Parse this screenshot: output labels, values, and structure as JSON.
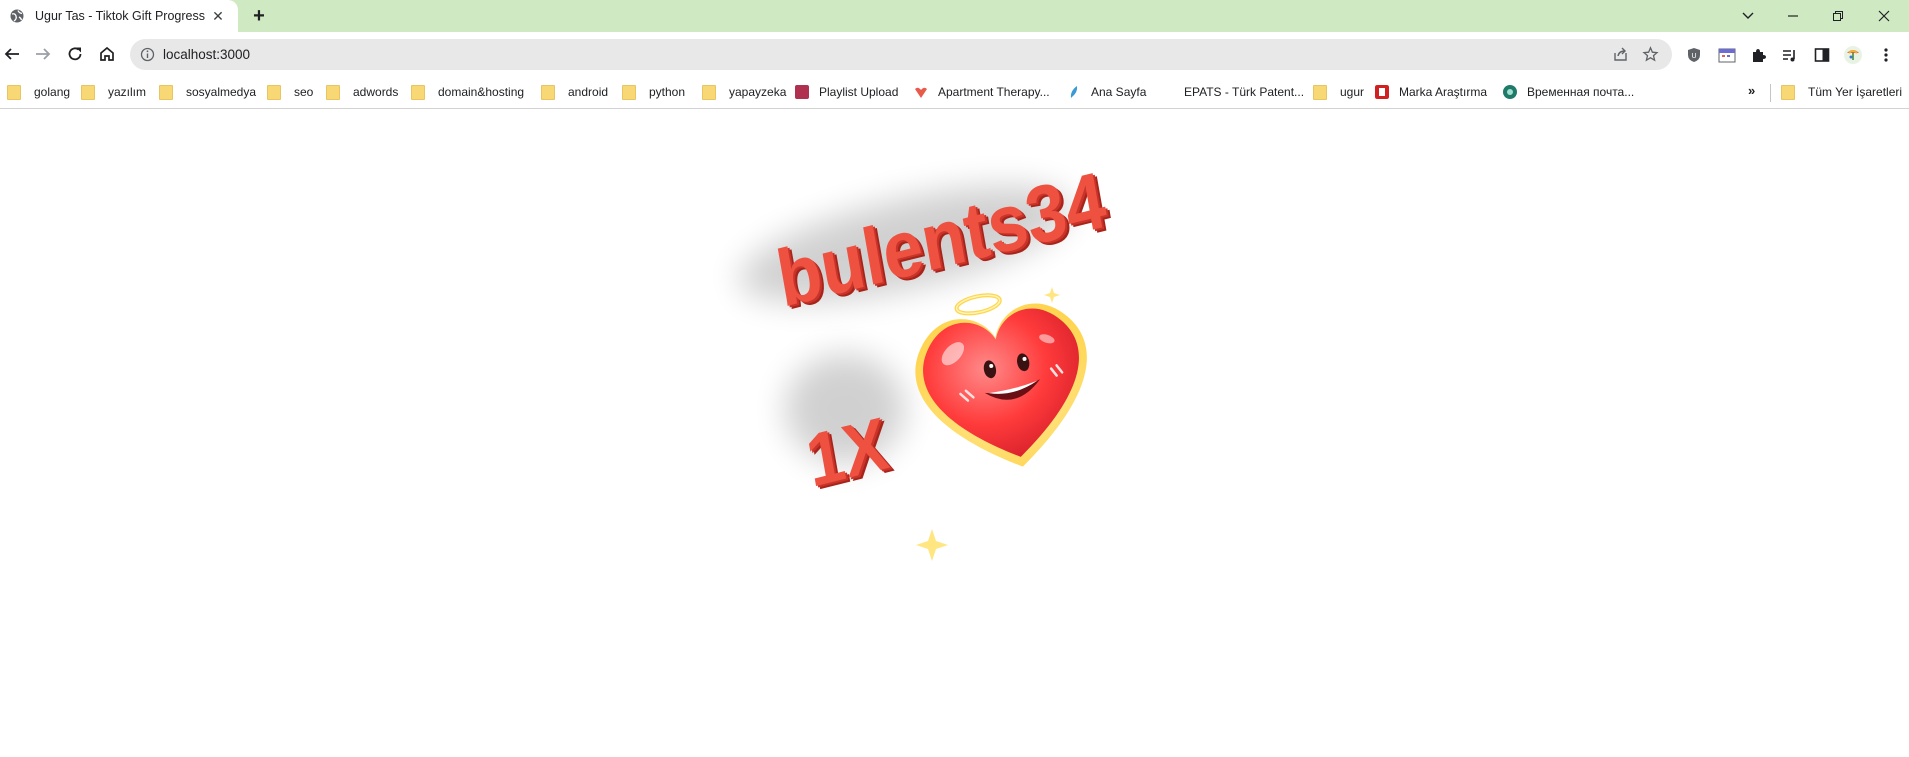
{
  "browser": {
    "tab_title": "Ugur Tas - Tiktok Gift Progress",
    "url": "localhost:3000",
    "bookmarks": [
      {
        "label": "golang",
        "kind": "folder"
      },
      {
        "label": "yazılım",
        "kind": "folder"
      },
      {
        "label": "sosyalmedya",
        "kind": "folder"
      },
      {
        "label": "seo",
        "kind": "folder"
      },
      {
        "label": "adwords",
        "kind": "folder"
      },
      {
        "label": "domain&hosting",
        "kind": "folder"
      },
      {
        "label": "android",
        "kind": "folder"
      },
      {
        "label": "python",
        "kind": "folder"
      },
      {
        "label": "yapayzeka",
        "kind": "folder"
      },
      {
        "label": "Playlist Upload",
        "kind": "site"
      },
      {
        "label": "Apartment Therapy...",
        "kind": "site"
      },
      {
        "label": "Ana Sayfa",
        "kind": "site"
      },
      {
        "label": "EPATS - Türk Patent...",
        "kind": "site"
      },
      {
        "label": "ugur",
        "kind": "folder"
      },
      {
        "label": "Marka Araştırma",
        "kind": "site"
      },
      {
        "label": "Временная почта...",
        "kind": "site"
      }
    ],
    "more_label": "»",
    "all_bookmarks_label": "Tüm Yer İşaretleri"
  },
  "page": {
    "username": "bulents34",
    "multiplier": "1X",
    "gift_icon": "heart-gift-icon"
  },
  "colors": {
    "tabstrip": "#cfe9c3",
    "text_front": "#e8483a",
    "text_side": "#b42a20",
    "heart": "#ff3b3b",
    "heart_glow": "#ffe27a"
  }
}
